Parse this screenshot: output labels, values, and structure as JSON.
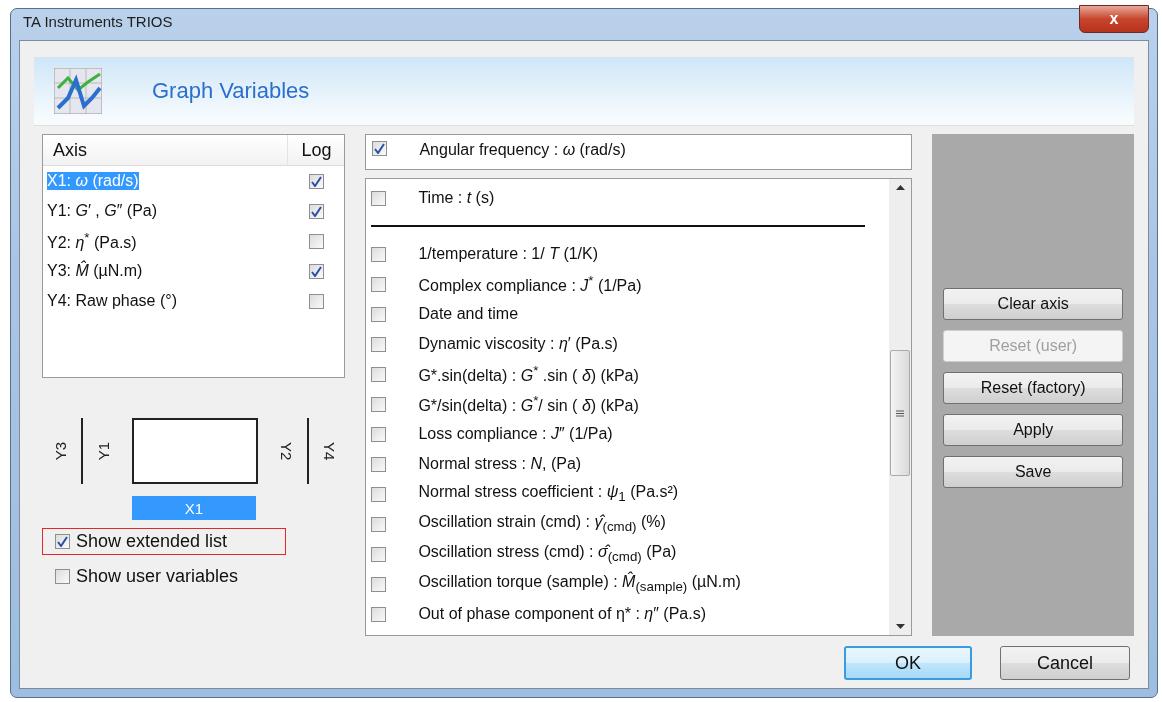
{
  "window": {
    "title": "TA Instruments TRIOS",
    "close": "x"
  },
  "header": {
    "title": "Graph Variables"
  },
  "axis_table": {
    "columns": [
      "Axis",
      "Log"
    ],
    "rows": [
      {
        "label": "X1:  *ω* (rad/s)",
        "log": true,
        "selected": true
      },
      {
        "label": "Y1:  *G*′ , *G*″ (Pa)",
        "log": true,
        "selected": false
      },
      {
        "label": "Y2:  *η*$^{*}$ (Pa.s)",
        "log": false,
        "selected": false
      },
      {
        "label": "Y3:  *M̂* (µN.m)",
        "log": true,
        "selected": false
      },
      {
        "label": "Y4: Raw phase (°)",
        "log": false,
        "selected": false
      }
    ]
  },
  "axis_diagram": {
    "left": [
      "Y3",
      "Y1"
    ],
    "right": [
      "Y2",
      "Y4"
    ],
    "bottom": "X1"
  },
  "options": [
    {
      "label": "Show extended list",
      "checked": true,
      "highlighted": true
    },
    {
      "label": "Show user variables",
      "checked": false,
      "highlighted": false
    }
  ],
  "current_variable": {
    "label": "Angular frequency :  *ω*  (rad/s)",
    "checked": true
  },
  "variables": [
    {
      "kind": "item",
      "label": "Time :  *t*  (s)",
      "checked": false
    },
    {
      "kind": "separator"
    },
    {
      "kind": "item",
      "label": "1/temperature : 1/ *T*  (1/K)",
      "checked": false
    },
    {
      "kind": "item",
      "label": "Complex compliance :  *J*$^{*}$  (1/Pa)",
      "checked": false
    },
    {
      "kind": "item",
      "label": "Date and time",
      "checked": false
    },
    {
      "kind": "item",
      "label": "Dynamic viscosity :  *η*′  (Pa.s)",
      "checked": false
    },
    {
      "kind": "item",
      "label": "G*.sin(delta) :  *G*$^{*}$ .sin ( *δ*)  (kPa)",
      "checked": false
    },
    {
      "kind": "item",
      "label": "G*/sin(delta) :  *G*$^{*}$/ sin ( *δ*)  (kPa)",
      "checked": false
    },
    {
      "kind": "item",
      "label": "Loss compliance :  *J*″  (1/Pa)",
      "checked": false
    },
    {
      "kind": "item",
      "label": "Normal stress :  *N*,  (Pa)",
      "checked": false
    },
    {
      "kind": "item",
      "label": "Normal stress coefficient :  *ψ*$_{1}$  (Pa.s²)",
      "checked": false
    },
    {
      "kind": "item",
      "label": "Oscillation strain (cmd) :  *γ̂*$_{(cmd)}$  (%)",
      "checked": false
    },
    {
      "kind": "item",
      "label": "Oscillation stress (cmd) :  *σ̂*$_{(cmd)}$  (Pa)",
      "checked": false
    },
    {
      "kind": "item",
      "label": "Oscillation torque (sample) :  *M̂*$_{(sample)}$  (µN.m)",
      "checked": false
    },
    {
      "kind": "item",
      "label": "Out of phase component of η* :  *η*″  (Pa.s)",
      "checked": false
    }
  ],
  "side_buttons": [
    {
      "label": "Clear axis",
      "disabled": false
    },
    {
      "label": "Reset (user)",
      "disabled": true
    },
    {
      "label": "Reset (factory)",
      "disabled": false
    },
    {
      "label": "Apply",
      "disabled": false
    },
    {
      "label": "Save",
      "disabled": false
    }
  ],
  "footer_buttons": [
    {
      "label": "OK",
      "default": true
    },
    {
      "label": "Cancel",
      "default": false
    }
  ]
}
